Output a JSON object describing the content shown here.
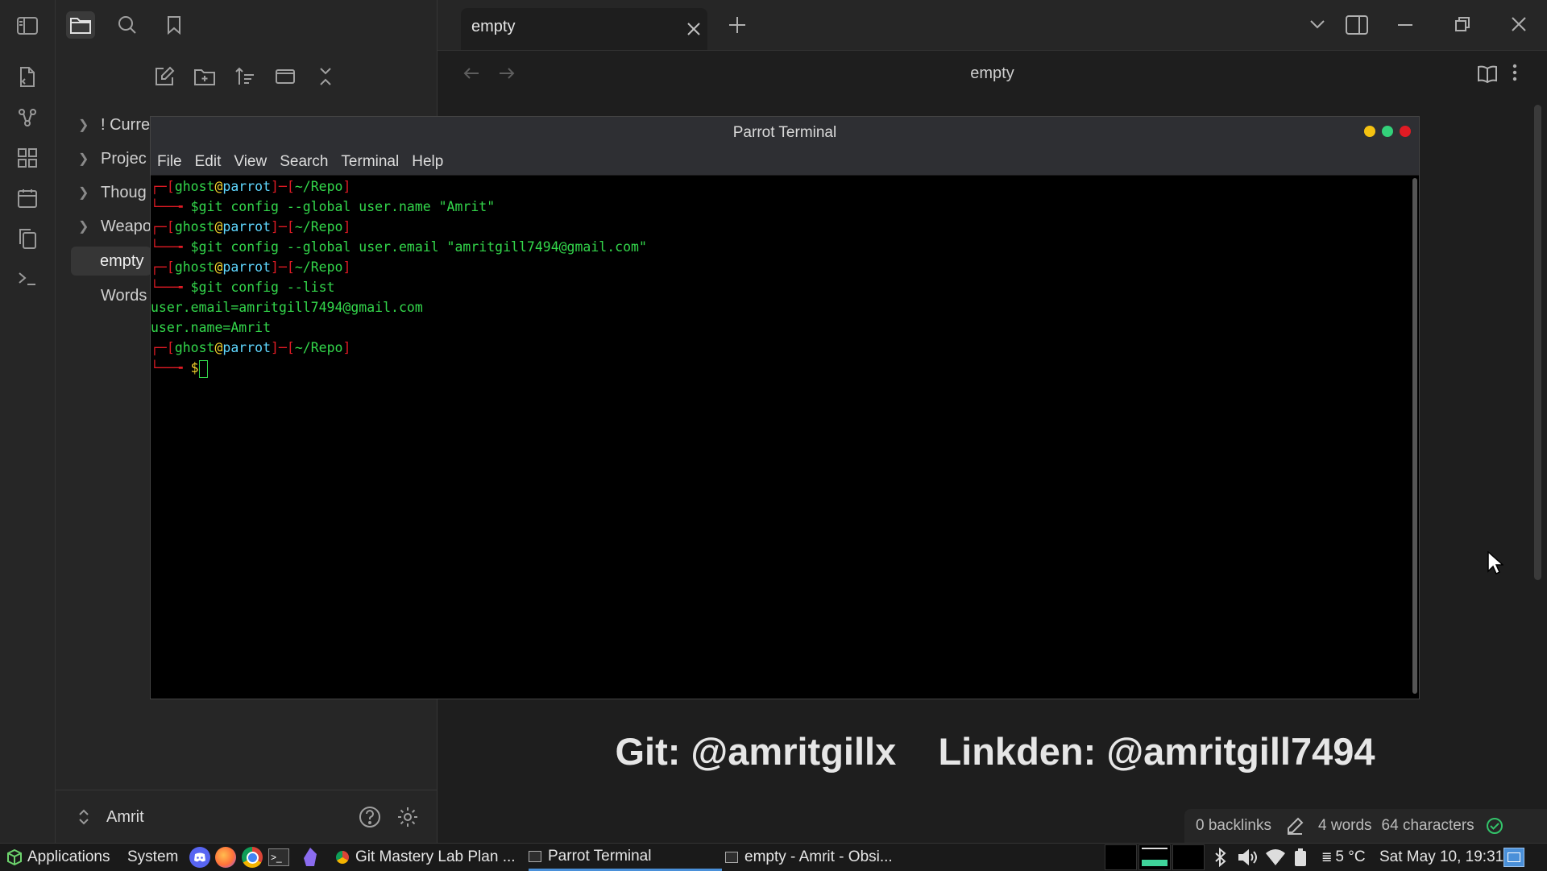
{
  "sidebar": {
    "tree": [
      {
        "label": "! Curre",
        "collapsed": true
      },
      {
        "label": "Projec",
        "collapsed": true
      },
      {
        "label": "Thoug",
        "collapsed": true
      },
      {
        "label": "Weapo",
        "collapsed": true
      },
      {
        "label": "empty",
        "active": true
      },
      {
        "label": "Words"
      }
    ],
    "vault_name": "Amrit"
  },
  "tab": {
    "title": "empty"
  },
  "note": {
    "title": "empty"
  },
  "banner": {
    "git": "Git: @amritgillx",
    "linkedin": "Linkden: @amritgill7494"
  },
  "status": {
    "backlinks": "0 backlinks",
    "words": "4 words",
    "chars": "64 characters"
  },
  "terminal": {
    "title": "Parrot Terminal",
    "menu": [
      "File",
      "Edit",
      "View",
      "Search",
      "Terminal",
      "Help"
    ],
    "prompt": {
      "user": "ghost",
      "host": "parrot",
      "path": "~/Repo"
    },
    "commands": [
      "$git config --global user.name \"Amrit\"",
      "$git config --global user.email \"amritgill7494@gmail.com\"",
      "$git config --list"
    ],
    "output": [
      "user.email=amritgill7494@gmail.com",
      "user.name=Amrit"
    ],
    "cursor_prompt": "$"
  },
  "taskbar": {
    "applications": "Applications",
    "system": "System",
    "windows": [
      "Git Mastery Lab Plan ...",
      "Parrot Terminal",
      "empty - Amrit - Obsi..."
    ],
    "weather": "5 °C",
    "clock": "Sat May 10, 19:31"
  },
  "colors": {
    "accent": "#4a90d9",
    "terminal_red": "#e01b24",
    "terminal_green": "#33d74b",
    "terminal_cyan": "#5fd7ff"
  }
}
